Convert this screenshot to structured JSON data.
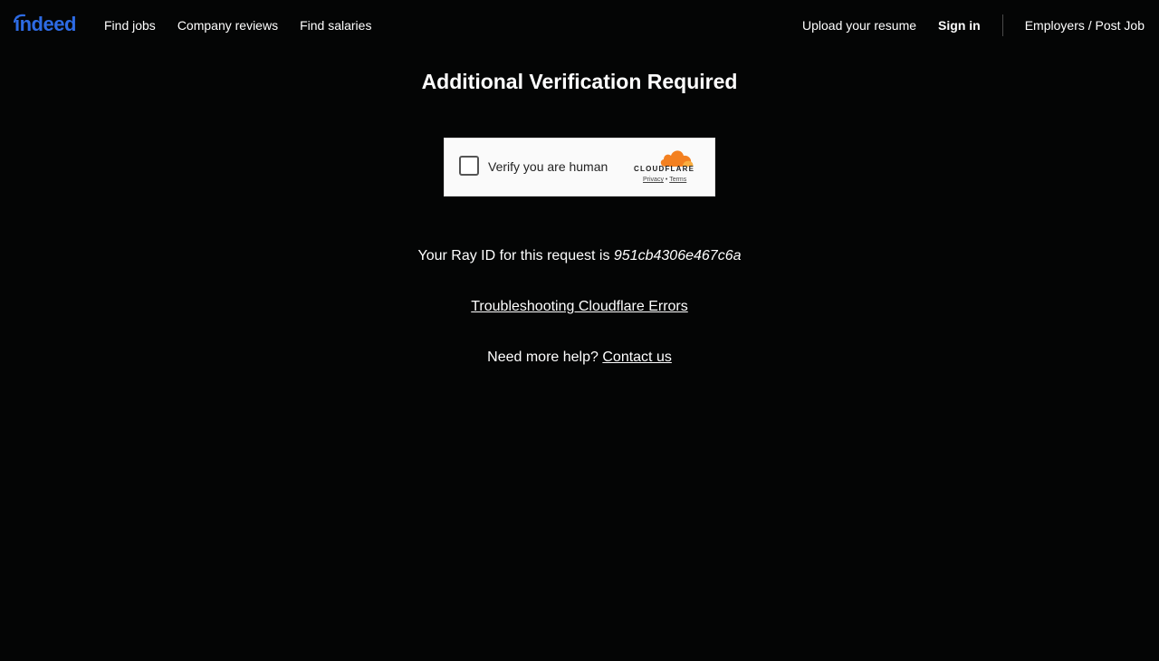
{
  "header": {
    "logo_text": "indeed",
    "nav_left": [
      "Find jobs",
      "Company reviews",
      "Find salaries"
    ],
    "upload_resume": "Upload your resume",
    "sign_in": "Sign in",
    "employers": "Employers / Post Job"
  },
  "main": {
    "title": "Additional Verification Required",
    "ray_prefix": "Your Ray ID for this request is",
    "ray_id": "951cb4306e467c6a",
    "troubleshooting_link": "Troubleshooting Cloudflare Errors",
    "help_prefix": "Need more help?",
    "contact_link": "Contact us"
  },
  "challenge": {
    "checkbox_label": "Verify you are human",
    "brand": "CLOUDFLARE",
    "privacy": "Privacy",
    "separator": "•",
    "terms": "Terms"
  },
  "colors": {
    "background": "#040505",
    "indeed_blue": "#2d6be4",
    "cloudflare_orange": "#f38020"
  }
}
